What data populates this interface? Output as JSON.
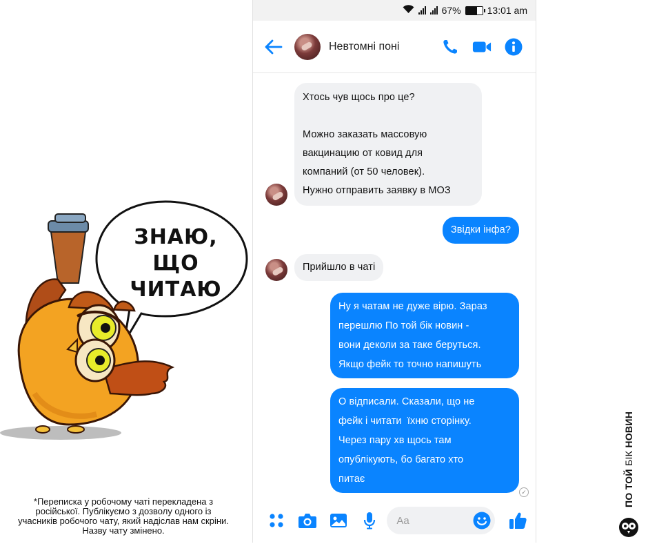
{
  "status_bar": {
    "battery": "67%",
    "time": "13:01 am"
  },
  "chat": {
    "title": "Невтомні поні",
    "icons": [
      "back-arrow-icon",
      "phone-icon",
      "video-camera-icon",
      "info-icon"
    ]
  },
  "messages": [
    {
      "from": "in",
      "text": "Хтось чув щось про це?\n\nМожно заказать массовую\nвакцинацию от ковид для\nкомпаний (от 50 человек).\nНужно отправить заявку в МОЗ"
    },
    {
      "from": "out",
      "text": "Звідки інфа?"
    },
    {
      "from": "in",
      "text": "Прийшло в чаті"
    },
    {
      "from": "out",
      "text": "Ну я чатам не дуже вірю. Зараз\nперешлю По той бік новин -\nвони деколи за таке беруться.\nЯкщо фейк то точно напишуть"
    },
    {
      "from": "out",
      "text": "О відписали. Сказали, що не\nфейк і читати  їхню сторінку.\nЧерез пару хв щось там\nопублікують, бо багато хто\nпитає"
    }
  ],
  "composer": {
    "placeholder": "Aa",
    "icons": [
      "menu-dots-icon",
      "camera-icon",
      "image-icon",
      "microphone-icon",
      "emoji-icon",
      "thumbs-up-icon"
    ]
  },
  "illustration": {
    "speech_line1": "ЗНАЮ,",
    "speech_line2": "ЩО ЧИТАЮ"
  },
  "footnote": "*Переписка у робочому чаті перекладена з російської. Публікуємо з дозволу одного із учасників робочого чату, який надіслав нам скріни. Назву чату змінено.",
  "brand": {
    "part1": "ПО ТОЙ ",
    "part2": "БІК",
    "part3": " НОВИН"
  },
  "colors": {
    "accent": "#0a84ff",
    "incoming_bubble": "#f0f1f3",
    "owl_body": "#f0a020",
    "owl_dark": "#9a3e10"
  }
}
